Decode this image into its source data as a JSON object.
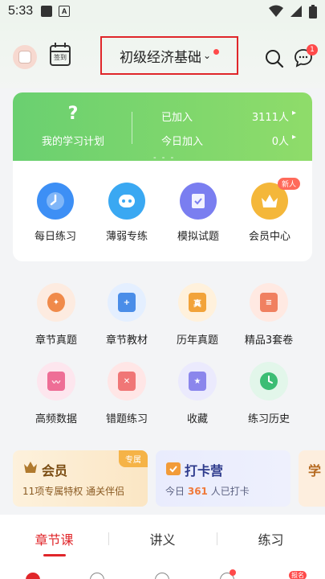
{
  "status_bar": {
    "time": "5:33",
    "app_icon_letter": "A"
  },
  "header": {
    "subject": "初级经济基础",
    "calendar_label": "签到",
    "message_badge": "1"
  },
  "study_plan": {
    "question_mark": "?",
    "label": "我的学习计划",
    "joined_label": "已加入",
    "joined_value": "3111人",
    "today_label": "今日加入",
    "today_value": "0人",
    "dashes": "- - -"
  },
  "quick_actions": [
    {
      "label": "每日练习",
      "icon": "clock-icon",
      "color": "#3d8ff5"
    },
    {
      "label": "薄弱专练",
      "icon": "robot-icon",
      "color": "#3aa8f2"
    },
    {
      "label": "模拟试题",
      "icon": "paper-icon",
      "color": "#7a7ef0"
    },
    {
      "label": "会员中心",
      "icon": "crown-icon",
      "color": "#f4b73a",
      "badge": "新人"
    }
  ],
  "grid": [
    {
      "label": "章节真题",
      "icon": "brain-icon",
      "bg": "#fdebe0",
      "fg": "#f08a4a"
    },
    {
      "label": "章节教材",
      "icon": "book-shield-icon",
      "bg": "#e4efff",
      "fg": "#4a8de8"
    },
    {
      "label": "历年真题",
      "icon": "folder-icon",
      "bg": "#fff1dc",
      "fg": "#f2a33a"
    },
    {
      "label": "精品3套卷",
      "icon": "list-icon",
      "bg": "#ffe9e2",
      "fg": "#f08060"
    },
    {
      "label": "高频数据",
      "icon": "chart-icon",
      "bg": "#fde6ee",
      "fg": "#ee6e96"
    },
    {
      "label": "错题练习",
      "icon": "error-book-icon",
      "bg": "#ffe6e6",
      "fg": "#f07676"
    },
    {
      "label": "收藏",
      "icon": "star-book-icon",
      "bg": "#ebeafd",
      "fg": "#8b86ec"
    },
    {
      "label": "练习历史",
      "icon": "history-icon",
      "bg": "#e2f6ea",
      "fg": "#3cbd74"
    }
  ],
  "promos": {
    "vip": {
      "title": "会员",
      "sub": "11项专属特权 通关伴侣",
      "tag": "专属"
    },
    "checkin": {
      "title": "打卡营",
      "sub_pre": "今日",
      "count": "361",
      "sub_post": "人已打卡"
    },
    "third": {
      "title": "学"
    }
  },
  "tabs": [
    "章节课",
    "讲义",
    "练习"
  ],
  "bottom_nav": {
    "badge": "报名"
  }
}
